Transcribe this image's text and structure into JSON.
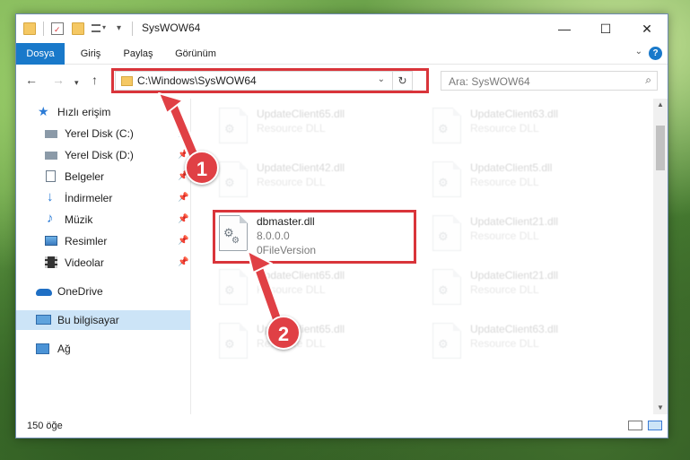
{
  "window": {
    "title": "SysWOW64",
    "controls": {
      "minimize": "—",
      "maximize": "☐",
      "close": "✕"
    }
  },
  "ribbon": {
    "tabs": [
      "Dosya",
      "Giriş",
      "Paylaş",
      "Görünüm"
    ],
    "help": "?"
  },
  "nav": {
    "address": "C:\\Windows\\SysWOW64",
    "search_placeholder": "Ara: SysWOW64"
  },
  "sidebar": {
    "quick_access": "Hızlı erişim",
    "items": [
      {
        "label": "Yerel Disk (C:)",
        "icon": "drive-icon",
        "pinned": true
      },
      {
        "label": "Yerel Disk (D:)",
        "icon": "drive-icon",
        "pinned": true
      },
      {
        "label": "Belgeler",
        "icon": "documents-icon",
        "pinned": true
      },
      {
        "label": "İndirmeler",
        "icon": "downloads-icon",
        "pinned": true
      },
      {
        "label": "Müzik",
        "icon": "music-icon",
        "pinned": true
      },
      {
        "label": "Resimler",
        "icon": "pictures-icon",
        "pinned": true
      },
      {
        "label": "Videolar",
        "icon": "videos-icon",
        "pinned": true
      }
    ],
    "onedrive": "OneDrive",
    "this_pc": "Bu bilgisayar",
    "network": "Ağ"
  },
  "files": {
    "left_column": [
      {
        "name": "UpdateClient65.dll",
        "type": "Resource DLL"
      },
      {
        "name": "UpdateClient42.dll",
        "type": "Resource DLL"
      },
      {
        "name": "dbmaster.dll",
        "version": "8.0.0.0",
        "type": "0FileVersion"
      },
      {
        "name": "UpdateClient65.dll",
        "type": "Resource DLL"
      },
      {
        "name": "UpdateClient65.dll",
        "type": "Resource DLL"
      }
    ],
    "right_column": [
      {
        "name": "UpdateClient63.dll",
        "type": "Resource DLL"
      },
      {
        "name": "UpdateClient5.dll",
        "type": "Resource DLL"
      },
      {
        "name": "UpdateClient21.dll",
        "type": "Resource DLL"
      },
      {
        "name": "UpdateClient21.dll",
        "type": "Resource DLL"
      },
      {
        "name": "UpdateClient63.dll",
        "type": "Resource DLL"
      }
    ]
  },
  "status": {
    "item_count": "150 öğe"
  },
  "annotations": {
    "step1": "1",
    "step2": "2"
  },
  "colors": {
    "accent": "#1979ca",
    "highlight": "#d9343a",
    "badge": "#e04045",
    "selected": "#cce4f7"
  }
}
